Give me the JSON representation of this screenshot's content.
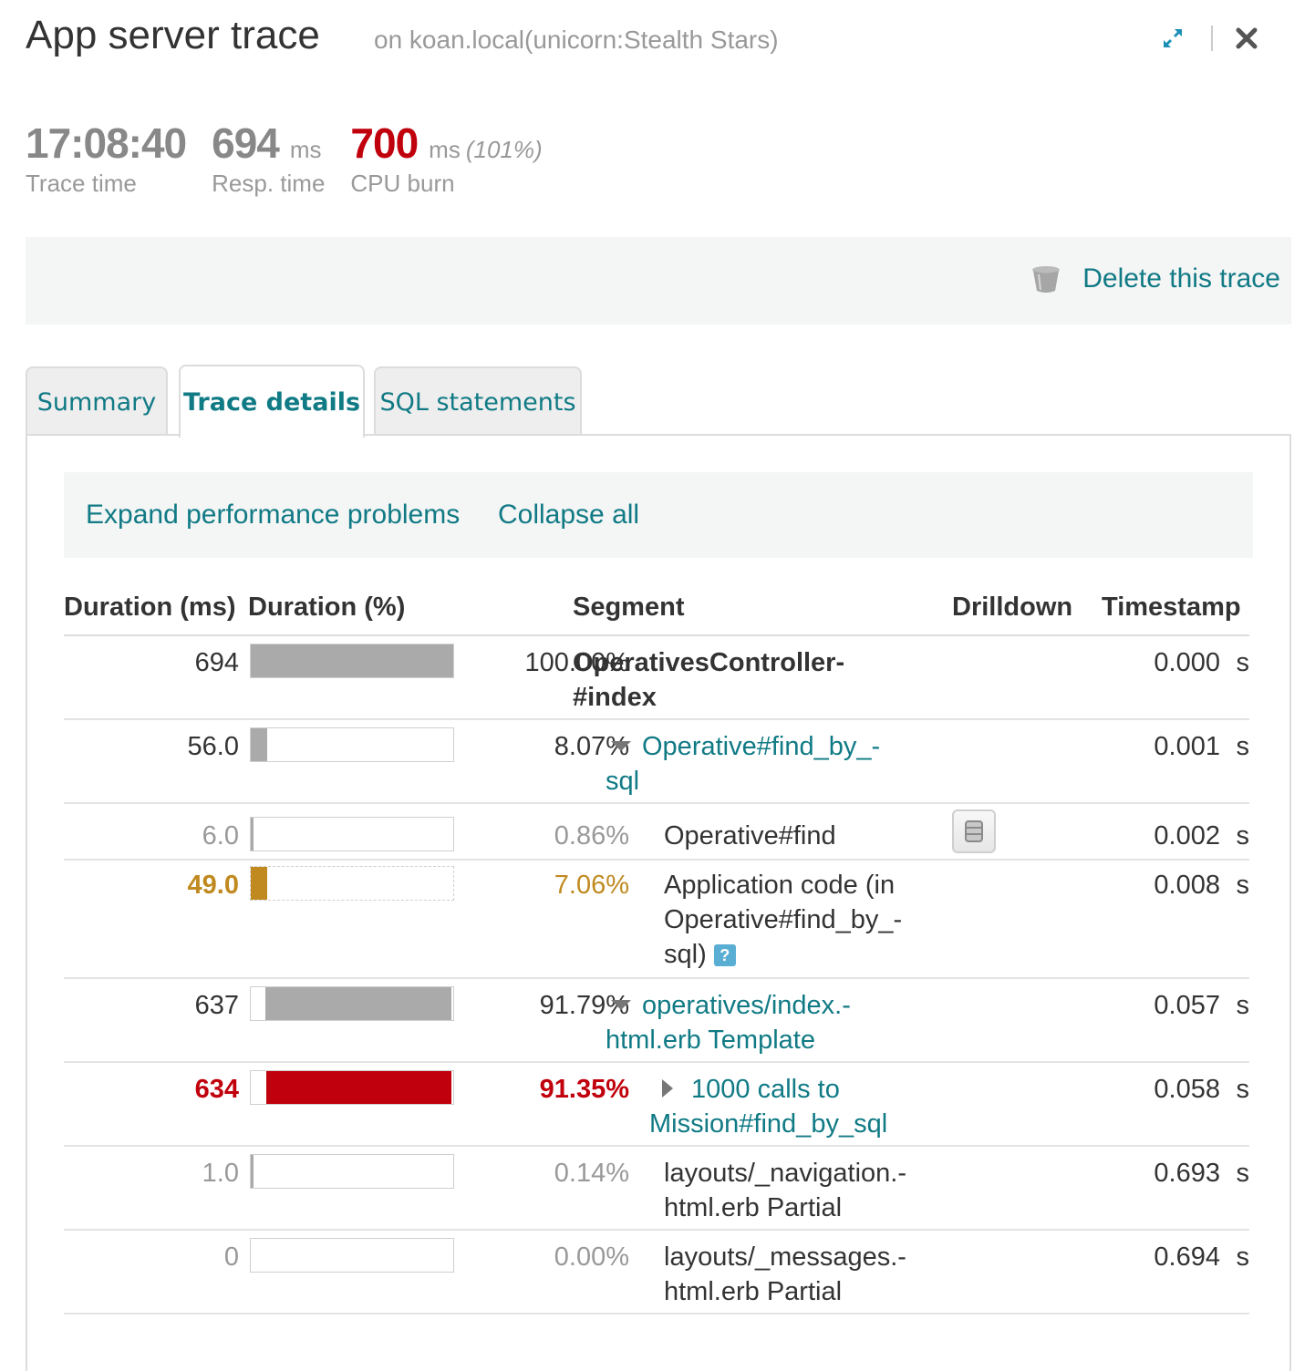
{
  "header": {
    "title": "App server trace",
    "subtitle": "on koan.local(unicorn:Stealth Stars)"
  },
  "metrics": {
    "trace_time": {
      "value": "17:08:40",
      "label": "Trace time"
    },
    "resp_time": {
      "value": "694",
      "unit": "ms",
      "label": "Resp. time"
    },
    "cpu_burn": {
      "value": "700",
      "unit": "ms",
      "extra": "(101%)",
      "label": "CPU burn"
    }
  },
  "actions": {
    "delete_label": "Delete this trace"
  },
  "tabs": [
    {
      "label": "Summary",
      "active": false
    },
    {
      "label": "Trace details",
      "active": true
    },
    {
      "label": "SQL statements",
      "active": false
    }
  ],
  "toolbar": {
    "expand_label": "Expand performance problems",
    "collapse_label": "Collapse all"
  },
  "table": {
    "columns": [
      "Duration (ms)",
      "Duration (%)",
      "Segment",
      "Drilldown",
      "Timestamp"
    ],
    "rows": [
      {
        "duration": "694",
        "percent": "100.00%",
        "fraction": 1.0,
        "segment_lines": [
          "OperativesController-",
          "#index"
        ],
        "timestamp": "0.000",
        "unit": "s"
      },
      {
        "duration": "56.0",
        "percent": "8.07%",
        "fraction": 0.0807,
        "segment_lines": [
          "Operative#find_by_-",
          "sql"
        ],
        "timestamp": "0.001",
        "unit": "s"
      },
      {
        "duration": "6.0",
        "percent": "0.86%",
        "fraction": 0.0086,
        "segment_lines": [
          "Operative#find"
        ],
        "timestamp": "0.002",
        "unit": "s"
      },
      {
        "duration": "49.0",
        "percent": "7.06%",
        "fraction": 0.0706,
        "segment_lines": [
          "Application code (in",
          "Operative#find_by_-",
          "sql)"
        ],
        "timestamp": "0.008",
        "unit": "s"
      },
      {
        "duration": "637",
        "percent": "91.79%",
        "fraction": 0.9179,
        "segment_lines": [
          "operatives/index.-",
          "html.erb Template"
        ],
        "timestamp": "0.057",
        "unit": "s"
      },
      {
        "duration": "634",
        "percent": "91.35%",
        "fraction": 0.9135,
        "segment_lines": [
          "1000 calls to",
          "Mission#find_by_sql"
        ],
        "timestamp": "0.058",
        "unit": "s"
      },
      {
        "duration": "1.0",
        "percent": "0.14%",
        "fraction": 0.0014,
        "segment_lines": [
          "layouts/_navigation.-",
          "html.erb Partial"
        ],
        "timestamp": "0.693",
        "unit": "s"
      },
      {
        "duration": "0",
        "percent": "0.00%",
        "fraction": 0.0,
        "segment_lines": [
          "layouts/_messages.-",
          "html.erb Partial"
        ],
        "timestamp": "0.694",
        "unit": "s"
      }
    ]
  },
  "colors": {
    "link": "#107a85",
    "bar_gray": "#aaaaaa",
    "bar_red": "#c0000c",
    "bar_gold": "#c08a20"
  }
}
